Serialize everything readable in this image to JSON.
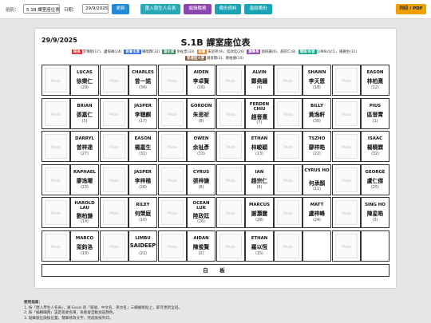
{
  "toolbar": {
    "class_label": "班別：",
    "class_value": "5.1B 課室座位表",
    "date_label": "日期：",
    "date_value": "29/9/2025",
    "update_button": "更新",
    "import_button": "匯入學生人名表",
    "layout_button": "編輯職務",
    "backup_button": "備份資料",
    "restore_button": "還原備份",
    "print_button": "列印 / PDF"
  },
  "colors": {
    "accent_blue": "#1f8bd7",
    "print_orange": "#f0a000",
    "tag_red": "#d63031",
    "tag_blue": "#2d6cdf",
    "tag_green": "#2e8b57",
    "tag_orange": "#e67e22",
    "tag_purple": "#8e44ad",
    "tag_teal": "#16a085",
    "tag_brown": "#7f5a3c"
  },
  "sheet": {
    "date": "29/9/2025",
    "title": "S.1B 課室座位表",
    "photo_placeholder": "Photo",
    "board_label": "白　板"
  },
  "legend": {
    "row1": [
      {
        "tag": "班長",
        "tag_color": "#d63031",
        "text": "李晴朗(17)、盧梓峰(24)"
      },
      {
        "tag": "班會主席",
        "tag_color": "#2d6cdf",
        "text": "楊曉霖(32)"
      },
      {
        "tag": "副主席",
        "tag_color": "#2e8b57",
        "text": "余祉彥(33)"
      },
      {
        "tag": "秘書",
        "tag_color": "#e67e22",
        "text": "朱思祈(9)、陸政廷(26)"
      },
      {
        "tag": "康樂長",
        "tag_color": "#8e44ad",
        "text": "張梓謙(6)、趙宗仁(8)"
      },
      {
        "tag": "環保/科普",
        "tag_color": "#16a085",
        "text": "LIMBU(21)、楊嘉生(31)"
      }
    ],
    "row2": [
      {
        "tag": "普通話大使",
        "tag_color": "#7f5a3c",
        "text": "趙晉霖(2)、劉柏謙(14)"
      }
    ]
  },
  "seats": [
    [
      [
        {
          "en": "LUCAS",
          "zh": "徐樂仁",
          "num": "(29)"
        },
        {
          "en": "CHARLES",
          "zh": "曾一諾",
          "num": "(34)"
        }
      ],
      [
        {
          "en": "AIDEN",
          "zh": "李卓賢",
          "num": "(16)"
        },
        {
          "en": "ALVIN",
          "zh": "鄭堯鐘",
          "num": "(4)"
        }
      ],
      [
        {
          "en": "SHAWN",
          "zh": "李天恩",
          "num": "(18)"
        },
        {
          "en": "EASON",
          "zh": "林柏熹",
          "num": "(12)"
        }
      ]
    ],
    [
      [
        {
          "en": "BRIAN",
          "zh": "張嘉仁",
          "num": "(5)"
        },
        {
          "en": "JASPER",
          "zh": "李聰麒",
          "num": "(17)"
        }
      ],
      [
        {
          "en": "GORDON",
          "zh": "朱思祈",
          "num": "(9)"
        },
        {
          "en": "FERDEN CHIU",
          "zh": "趙晉熹",
          "num": "(7)"
        }
      ],
      [
        {
          "en": "BILLY",
          "zh": "黃逸軒",
          "num": "(30)"
        },
        {
          "en": "PIUS",
          "zh": "區晉霄",
          "num": "(1)"
        }
      ]
    ],
    [
      [
        {
          "en": "DARRYL",
          "zh": "曾梓達",
          "num": "(27)"
        },
        {
          "en": "EASON",
          "zh": "楊嘉生",
          "num": "(31)"
        }
      ],
      [
        {
          "en": "OWEN",
          "zh": "余祉彥",
          "num": "(33)"
        },
        {
          "en": "ETHAN",
          "zh": "林峻穎",
          "num": "(13)"
        }
      ],
      [
        {
          "en": "TSZHO",
          "zh": "廖梓皓",
          "num": "(22)"
        },
        {
          "en": "ISAAC",
          "zh": "楊曉霖",
          "num": "(32)"
        }
      ]
    ],
    [
      [
        {
          "en": "RAPHAEL",
          "zh": "廖逸曜",
          "num": "(23)"
        },
        {
          "en": "JASPER",
          "zh": "李梓楷",
          "num": "(20)"
        }
      ],
      [
        {
          "en": "CYRUS",
          "zh": "張梓謙",
          "num": "(6)"
        },
        {
          "en": "IAN",
          "zh": "趙宗仁",
          "num": "(8)"
        }
      ],
      [
        {
          "en": "CYRUS HO",
          "zh": "何承顏",
          "num": "(11)"
        },
        {
          "en": "GEORGE",
          "zh": "盧仁傑",
          "num": "(25)"
        }
      ]
    ],
    [
      [
        {
          "en": "HAROLD LAU",
          "zh": "劉柏謙",
          "num": "(14)"
        },
        {
          "en": "RILEY",
          "zh": "何榮庭",
          "num": "(10)"
        }
      ],
      [
        {
          "en": "OCEAN LUK",
          "zh": "陸政廷",
          "num": "(26)"
        },
        {
          "en": "MARCUS",
          "zh": "謝灝霆",
          "num": "(28)"
        }
      ],
      [
        {
          "en": "MATT",
          "zh": "盧梓峰",
          "num": "(24)"
        },
        {
          "en": "SING HO",
          "zh": "陳星皓",
          "num": "(3)"
        }
      ]
    ],
    [
      [
        {
          "en": "MARCO",
          "zh": "梁鈞洛",
          "num": "(19)"
        },
        {
          "en": "LIMBU",
          "zh": "SAIDEEP",
          "num": "(21)"
        }
      ],
      [
        {
          "en": "AIDAN",
          "zh": "陳俊賢",
          "num": "(2)"
        },
        {
          "en": "ETHAN",
          "zh": "羅以恆",
          "num": "(15)"
        }
      ],
      [
        null,
        null
      ]
    ]
  ],
  "instructions": {
    "title": "使用指南：",
    "line1": "1. 按「匯入學生人名表」，將 Excel 的「座號、中文名、英文名」三欄複製貼上，即可更新全班。",
    "line2": "2. 按「編輯職務」設定班委名單，系統會自動加註顏色。",
    "line3": "3. 點擊座位調換位置，雙擊修改文字，完成後按列印。"
  }
}
